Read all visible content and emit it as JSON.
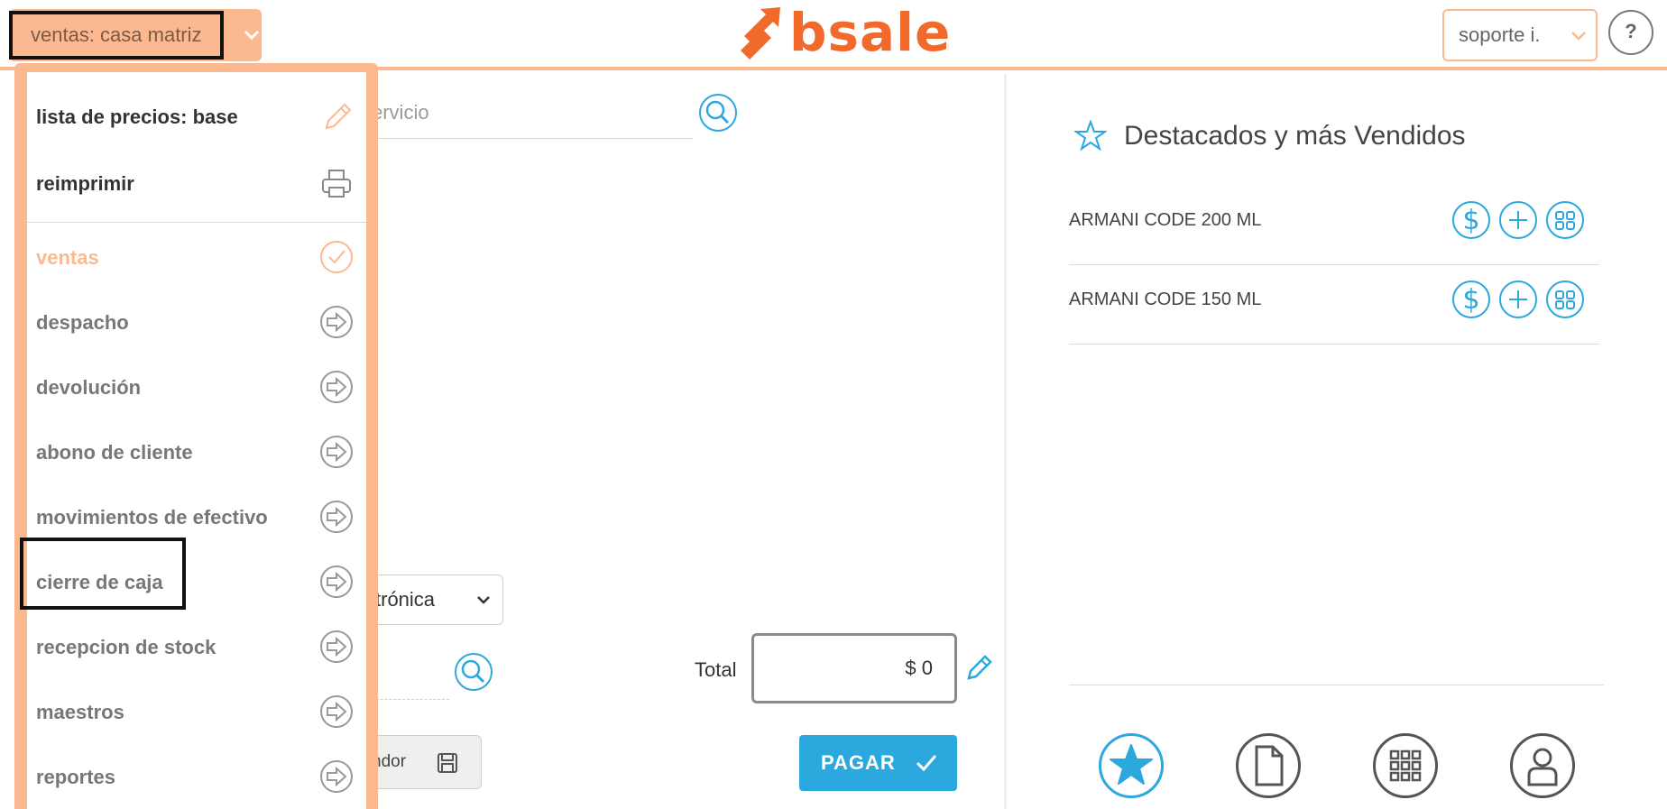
{
  "header": {
    "branch_label": "ventas: casa matriz",
    "logo_text": "bsale",
    "user_label": "soporte i.",
    "help_label": "?"
  },
  "menu": {
    "items": [
      {
        "label": "lista de precios: base",
        "icon": "pencil-icon"
      },
      {
        "label": "reimprimir",
        "icon": "printer-icon"
      },
      {
        "label": "ventas",
        "icon": "check-circle-icon"
      },
      {
        "label": "despacho",
        "icon": "arrow-right-circle-icon"
      },
      {
        "label": "devolución",
        "icon": "arrow-right-circle-icon"
      },
      {
        "label": "abono de cliente",
        "icon": "arrow-right-circle-icon"
      },
      {
        "label": "movimientos de efectivo",
        "icon": "arrow-right-circle-icon"
      },
      {
        "label": "cierre de caja",
        "icon": "arrow-right-circle-icon"
      },
      {
        "label": "recepcion de stock",
        "icon": "arrow-right-circle-icon"
      },
      {
        "label": "maestros",
        "icon": "arrow-right-circle-icon"
      },
      {
        "label": "reportes",
        "icon": "arrow-right-circle-icon"
      }
    ]
  },
  "main": {
    "search_placeholder_partial": "ervicio",
    "document_type_partial": "trónica",
    "save_label_partial": "ndor",
    "total_label": "Total",
    "total_value": "$ 0",
    "pay_label": "PAGAR"
  },
  "featured": {
    "title": "Destacados y más Vendidos",
    "products": [
      {
        "name": "ARMANI CODE 200 ML"
      },
      {
        "name": "ARMANI CODE 150 ML"
      }
    ]
  },
  "bottom_nav": [
    "star-icon",
    "document-icon",
    "grid-icon",
    "user-icon"
  ],
  "colors": {
    "accent_orange": "#fcb990",
    "brand_orange": "#f26a2b",
    "accent_blue": "#2ba8de"
  }
}
